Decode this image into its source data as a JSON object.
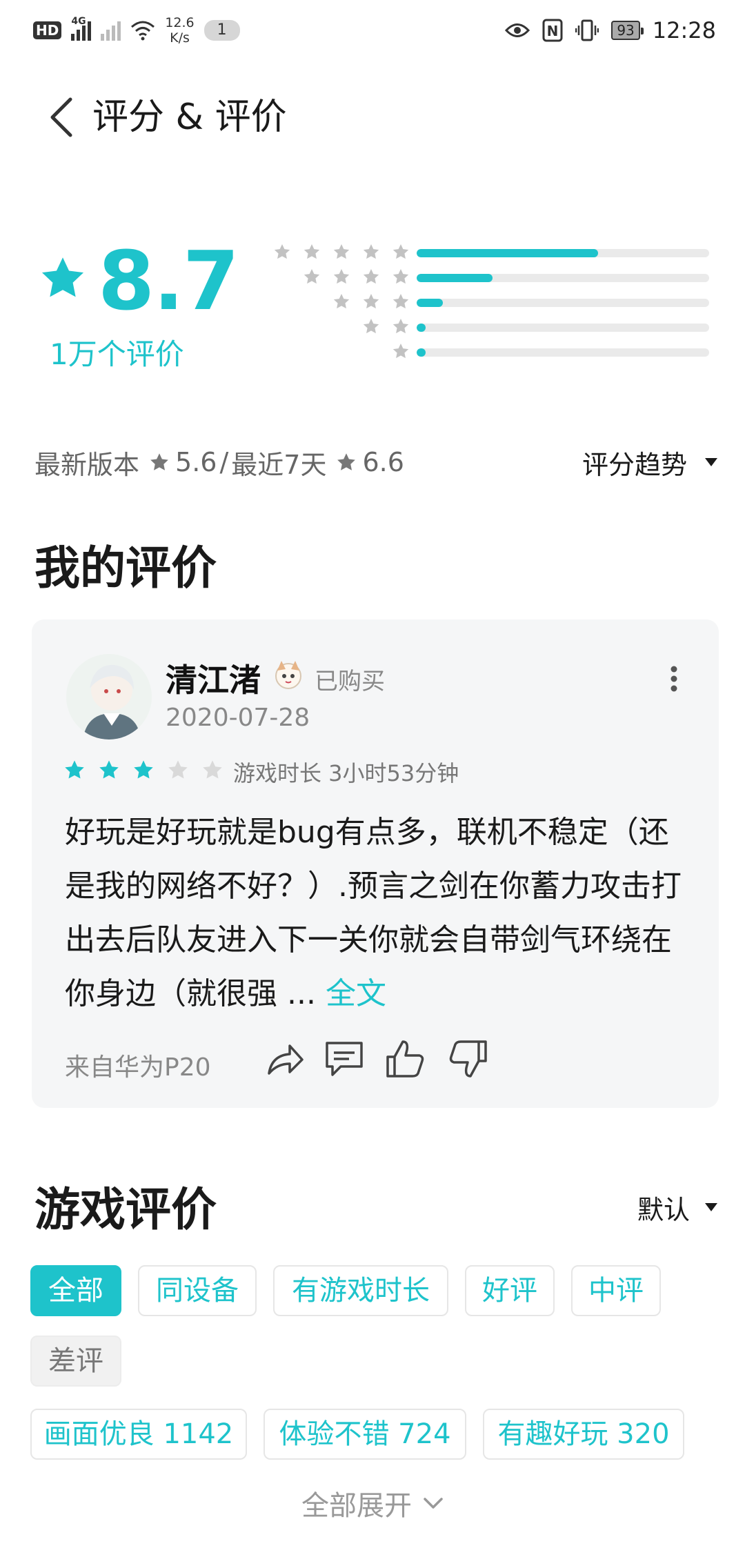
{
  "status_bar": {
    "hd": "HD",
    "net": "4G",
    "speed_value": "12.6",
    "speed_unit": "K/s",
    "notifications": "1",
    "nfc": "N",
    "battery": "93",
    "time": "12:28"
  },
  "header": {
    "title": "评分 & 评价"
  },
  "summary": {
    "score": "8.7",
    "count": "1万个评价",
    "distribution": [
      {
        "stars": 5,
        "fraction": 0.62
      },
      {
        "stars": 4,
        "fraction": 0.26
      },
      {
        "stars": 3,
        "fraction": 0.09
      },
      {
        "stars": 2,
        "fraction": 0.03
      },
      {
        "stars": 1,
        "fraction": 0.03
      }
    ]
  },
  "version": {
    "latest_label": "最新版本",
    "latest_score": "5.6",
    "separator": "/",
    "recent_label": "最近7天",
    "recent_score": "6.6",
    "trend_label": "评分趋势"
  },
  "my_review": {
    "section_title": "我的评价",
    "username": "清江渚",
    "purchased": "已购买",
    "date": "2020-07-28",
    "rating": 3,
    "playtime": "游戏时长 3小时53分钟",
    "text": "好玩是好玩就是bug有点多，联机不稳定（还是我的网络不好？）.预言之剑在你蓄力攻击打出去后队友进入下一关你就会自带剑气环绕在你身边（就很强 ...",
    "read_more": "全文",
    "device": "来自华为P20"
  },
  "game_reviews": {
    "section_title": "游戏评价",
    "sort_label": "默认",
    "filters": [
      "全部",
      "同设备",
      "有游戏时长",
      "好评",
      "中评",
      "差评"
    ],
    "tags": [
      "画面优良 1142",
      "体验不错 724",
      "有趣好玩 320"
    ],
    "expand_label": "全部展开"
  },
  "colors": {
    "accent": "#1ec3cb",
    "star_empty": "#d9d9d9",
    "text_secondary": "#888888"
  }
}
